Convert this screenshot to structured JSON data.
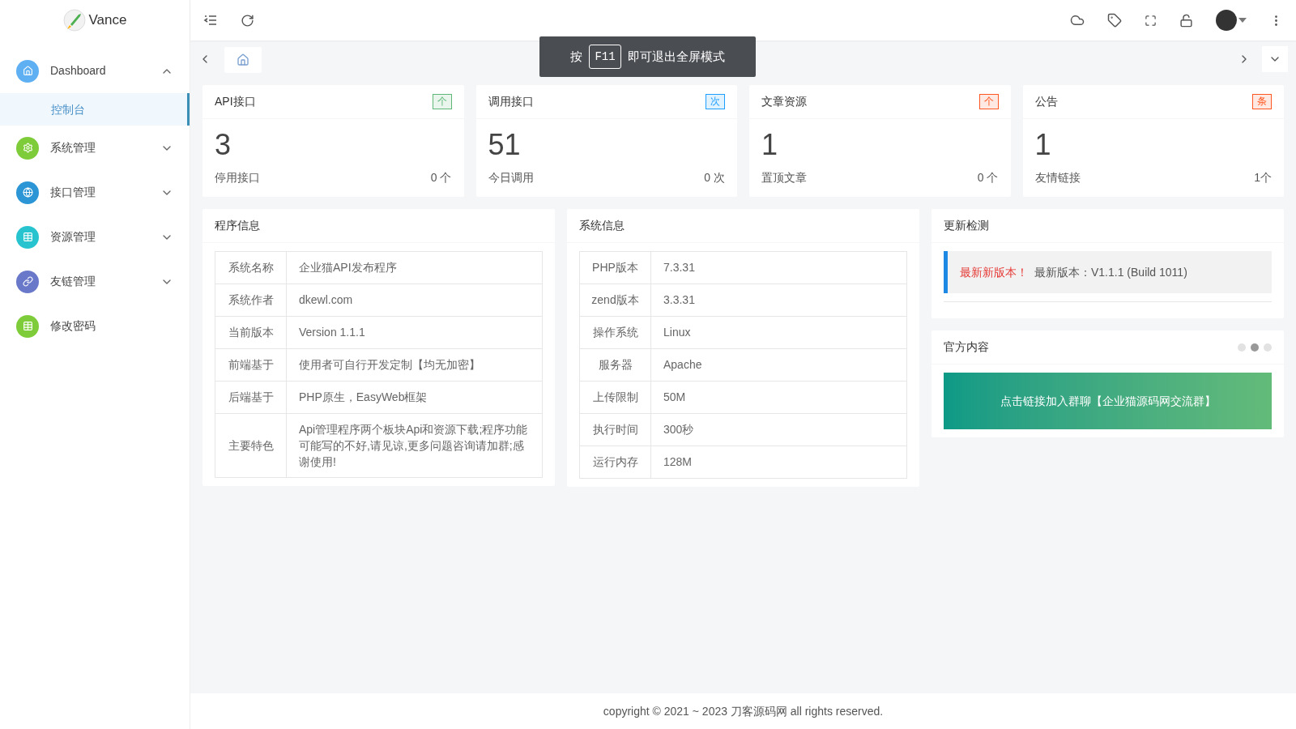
{
  "sidebar": {
    "logo_text": "Vance",
    "items": [
      {
        "label": "Dashboard",
        "color": "#5fb0f3",
        "expanded": true,
        "children": [
          {
            "label": "控制台",
            "selected": true
          }
        ]
      },
      {
        "label": "系统管理",
        "color": "#7fcc3a",
        "expanded": false
      },
      {
        "label": "接口管理",
        "color": "#2b95d6",
        "expanded": false
      },
      {
        "label": "资源管理",
        "color": "#27c4cf",
        "expanded": false
      },
      {
        "label": "友链管理",
        "color": "#6a78c9",
        "expanded": false
      },
      {
        "label": "修改密码",
        "color": "#7fcc3a"
      }
    ]
  },
  "toast": {
    "before": "按",
    "key": "F11",
    "after": "即可退出全屏模式"
  },
  "stat_cards": [
    {
      "title": "API接口",
      "badge": "个",
      "color": "#5fb878",
      "value": "3",
      "footer_label": "停用接口",
      "footer_value": "0 个"
    },
    {
      "title": "调用接口",
      "badge": "次",
      "color": "#1e9fff",
      "value": "51",
      "footer_label": "今日调用",
      "footer_value": "0 次"
    },
    {
      "title": "文章资源",
      "badge": "个",
      "color": "#ff5722",
      "value": "1",
      "footer_label": "置顶文章",
      "footer_value": "0 个"
    },
    {
      "title": "公告",
      "badge": "条",
      "color": "#ff5722",
      "value": "1",
      "footer_label": "友情链接",
      "footer_value": "1个"
    }
  ],
  "program_info": {
    "title": "程序信息",
    "rows": [
      {
        "label": "系统名称",
        "value": "企业猫API发布程序"
      },
      {
        "label": "系统作者",
        "value": "dkewl.com"
      },
      {
        "label": "当前版本",
        "value": "Version 1.1.1"
      },
      {
        "label": "前端基于",
        "value": "使用者可自行开发定制【均无加密】"
      },
      {
        "label": "后端基于",
        "value": "PHP原生，EasyWeb框架"
      },
      {
        "label": "主要特色",
        "value": "Api管理程序两个板块Api和资源下载;程序功能可能写的不好,请见谅,更多问题咨询请加群;感谢使用!"
      }
    ]
  },
  "system_info": {
    "title": "系统信息",
    "rows": [
      {
        "label": "PHP版本",
        "value": "7.3.31"
      },
      {
        "label": "zend版本",
        "value": "3.3.31"
      },
      {
        "label": "操作系统",
        "value": "Linux"
      },
      {
        "label": "服务器",
        "value": "Apache"
      },
      {
        "label": "上传限制",
        "value": "50M"
      },
      {
        "label": "执行时间",
        "value": "300秒"
      },
      {
        "label": "运行内存",
        "value": "128M"
      }
    ]
  },
  "update_check": {
    "title": "更新检测",
    "highlight": "最新新版本！",
    "text": "最新版本：V1.1.1 (Build 1011)"
  },
  "official": {
    "title": "官方内容",
    "dots": [
      {
        "selected": false
      },
      {
        "selected": true
      },
      {
        "selected": false
      }
    ],
    "banner": "点击链接加入群聊【企业猫源码网交流群】"
  },
  "footer": "copyright © 2021 ~ 2023 刀客源码网 all rights reserved."
}
